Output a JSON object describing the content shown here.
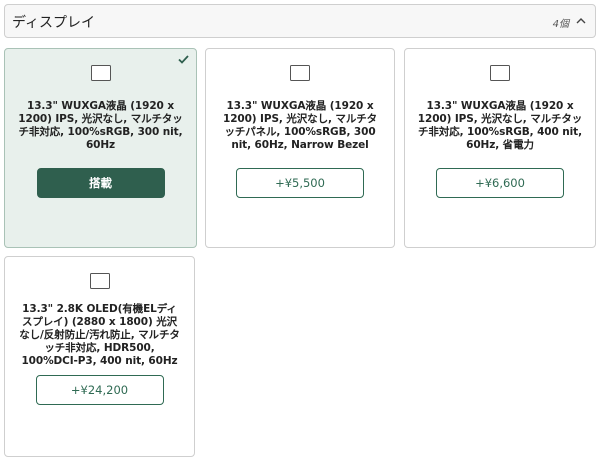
{
  "section": {
    "title": "ディスプレイ",
    "count": "4個"
  },
  "options": [
    {
      "description": "13.3\" WUXGA液晶 (1920 x 1200) IPS, 光沢なし, マルチタッチ非対応, 100%sRGB, 300 nit, 60Hz",
      "button_label": "搭載",
      "selected": true
    },
    {
      "description": "13.3\" WUXGA液晶 (1920 x 1200) IPS, 光沢なし, マルチタッチパネル, 100%sRGB, 300 nit, 60Hz, Narrow Bezel",
      "button_label": "+¥5,500",
      "selected": false
    },
    {
      "description": "13.3\" WUXGA液晶 (1920 x 1200) IPS, 光沢なし, マルチタッチ非対応, 100%sRGB, 400 nit, 60Hz, 省電力",
      "button_label": "+¥6,600",
      "selected": false
    },
    {
      "description": "13.3\" 2.8K OLED(有機ELディスプレイ) (2880 x 1800) 光沢なし/反射防止/汚れ防止, マルチタッチ非対応, HDR500, 100%DCI-P3, 400 nit, 60Hz",
      "button_label": "+¥24,200",
      "selected": false
    }
  ],
  "colors": {
    "accent": "#2f5f4e",
    "selected_bg": "#e8f0ec",
    "border": "#cfcfcf"
  },
  "icons": {
    "collapse": "chevron-up-icon",
    "selected": "check-icon",
    "image": "image-placeholder-icon"
  }
}
